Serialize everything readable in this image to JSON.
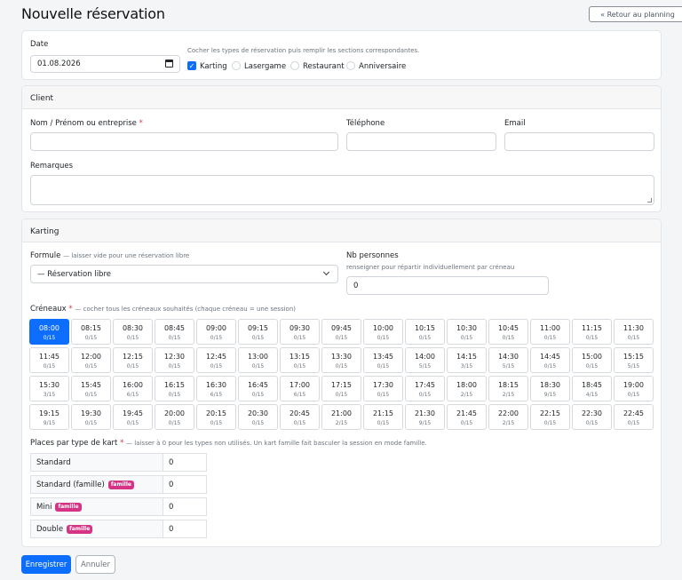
{
  "page": {
    "title": "Nouvelle réservation",
    "back_label": "« Retour au planning"
  },
  "top": {
    "date_label": "Date",
    "date_value": "01.08.2026",
    "hint": "Cocher les types de réservation puis remplir les sections correspondantes.",
    "types": [
      {
        "label": "Karting",
        "checked": true
      },
      {
        "label": "Lasergame",
        "checked": false
      },
      {
        "label": "Restaurant",
        "checked": false
      },
      {
        "label": "Anniversaire",
        "checked": false
      }
    ]
  },
  "client": {
    "header": "Client",
    "name_label": "Nom / Prénom ou entreprise",
    "required_mark": "*",
    "phone_label": "Téléphone",
    "email_label": "Email",
    "remarks_label": "Remarques"
  },
  "karting": {
    "header": "Karting",
    "formule_label": "Formule",
    "formule_hint": "— laisser vide pour une réservation libre",
    "formule_value": "— Réservation libre",
    "nb_label": "Nb personnes",
    "nb_hint": "renseigner pour répartir individuellement par créneau",
    "nb_value": "0",
    "creneaux_label": "Créneaux",
    "creneaux_hint": "— cocher tous les créneaux souhaités (chaque créneau = une session)",
    "slots": [
      {
        "time": "08:00",
        "count": "0/15",
        "selected": true
      },
      {
        "time": "08:15",
        "count": "0/15"
      },
      {
        "time": "08:30",
        "count": "0/15"
      },
      {
        "time": "08:45",
        "count": "0/15"
      },
      {
        "time": "09:00",
        "count": "0/15"
      },
      {
        "time": "09:15",
        "count": "0/15"
      },
      {
        "time": "09:30",
        "count": "0/15"
      },
      {
        "time": "09:45",
        "count": "0/15"
      },
      {
        "time": "10:00",
        "count": "0/15"
      },
      {
        "time": "10:15",
        "count": "0/15"
      },
      {
        "time": "10:30",
        "count": "0/15"
      },
      {
        "time": "10:45",
        "count": "0/15"
      },
      {
        "time": "11:00",
        "count": "0/15"
      },
      {
        "time": "11:15",
        "count": "0/15"
      },
      {
        "time": "11:30",
        "count": "0/15"
      },
      {
        "time": "11:45",
        "count": "0/15"
      },
      {
        "time": "12:00",
        "count": "0/15"
      },
      {
        "time": "12:15",
        "count": "0/15"
      },
      {
        "time": "12:30",
        "count": "0/15"
      },
      {
        "time": "12:45",
        "count": "0/15"
      },
      {
        "time": "13:00",
        "count": "0/15"
      },
      {
        "time": "13:15",
        "count": "0/15"
      },
      {
        "time": "13:30",
        "count": "0/15"
      },
      {
        "time": "13:45",
        "count": "0/15"
      },
      {
        "time": "14:00",
        "count": "5/15"
      },
      {
        "time": "14:15",
        "count": "3/15"
      },
      {
        "time": "14:30",
        "count": "5/15"
      },
      {
        "time": "14:45",
        "count": "0/15"
      },
      {
        "time": "15:00",
        "count": "0/15"
      },
      {
        "time": "15:15",
        "count": "5/15"
      },
      {
        "time": "15:30",
        "count": "3/15"
      },
      {
        "time": "15:45",
        "count": "0/15"
      },
      {
        "time": "16:00",
        "count": "6/15"
      },
      {
        "time": "16:15",
        "count": "0/15"
      },
      {
        "time": "16:30",
        "count": "6/15"
      },
      {
        "time": "16:45",
        "count": "0/15"
      },
      {
        "time": "17:00",
        "count": "6/15"
      },
      {
        "time": "17:15",
        "count": "0/15"
      },
      {
        "time": "17:30",
        "count": "0/15"
      },
      {
        "time": "17:45",
        "count": "0/15"
      },
      {
        "time": "18:00",
        "count": "2/15"
      },
      {
        "time": "18:15",
        "count": "2/15"
      },
      {
        "time": "18:30",
        "count": "9/15"
      },
      {
        "time": "18:45",
        "count": "4/15"
      },
      {
        "time": "19:00",
        "count": "0/15"
      },
      {
        "time": "19:15",
        "count": "9/15"
      },
      {
        "time": "19:30",
        "count": "0/15"
      },
      {
        "time": "19:45",
        "count": "0/15"
      },
      {
        "time": "20:00",
        "count": "0/15"
      },
      {
        "time": "20:15",
        "count": "0/15"
      },
      {
        "time": "20:30",
        "count": "0/15"
      },
      {
        "time": "20:45",
        "count": "0/15"
      },
      {
        "time": "21:00",
        "count": "2/15"
      },
      {
        "time": "21:15",
        "count": "0/15"
      },
      {
        "time": "21:30",
        "count": "9/15"
      },
      {
        "time": "21:45",
        "count": "0/15"
      },
      {
        "time": "22:00",
        "count": "2/15"
      },
      {
        "time": "22:15",
        "count": "0/15"
      },
      {
        "time": "22:30",
        "count": "0/15"
      },
      {
        "time": "22:45",
        "count": "0/15"
      }
    ],
    "places_label": "Places par type de kart",
    "places_hint": "— laisser à 0 pour les types non utilisés. Un kart famille fait basculer la session en mode famille.",
    "kart_types": [
      {
        "name": "Standard",
        "badge": "",
        "value": "0"
      },
      {
        "name": "Standard (famille)",
        "badge": "famille",
        "value": "0"
      },
      {
        "name": "Mini",
        "badge": "famille",
        "value": "0"
      },
      {
        "name": "Double",
        "badge": "famille",
        "value": "0"
      }
    ]
  },
  "actions": {
    "save_label": "Enregistrer",
    "cancel_label": "Annuler"
  },
  "colors": {
    "accent": "#0d6efd",
    "badge": "#d63384",
    "required": "#dc3545"
  }
}
